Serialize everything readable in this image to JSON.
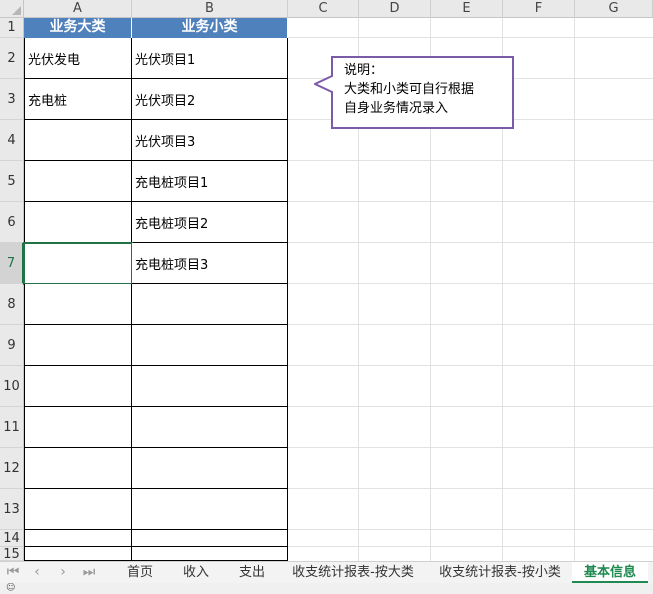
{
  "columns": [
    "A",
    "B",
    "C",
    "D",
    "E",
    "F",
    "G"
  ],
  "rows": [
    "1",
    "2",
    "3",
    "4",
    "5",
    "6",
    "7",
    "8",
    "9",
    "10",
    "11",
    "12",
    "13",
    "14",
    "15"
  ],
  "active_row": "7",
  "table": {
    "header": {
      "col_a": "业务大类",
      "col_b": "业务小类"
    },
    "col_a_values": [
      "光伏发电",
      "充电桩",
      "",
      "",
      "",
      "",
      "",
      "",
      "",
      "",
      "",
      "",
      "",
      ""
    ],
    "col_b_values": [
      "光伏项目1",
      "光伏项目2",
      "光伏项目3",
      "充电桩项目1",
      "充电桩项目2",
      "充电桩项目3",
      "",
      "",
      "",
      "",
      "",
      "",
      "",
      ""
    ]
  },
  "callout": {
    "text": "说明：\n大类和小类可自行根据\n自身业务情况录入"
  },
  "sheet_tabs": {
    "nav": [
      "|<",
      "<",
      ">",
      ">|"
    ],
    "tabs": [
      "首页",
      "收入",
      "支出",
      "收支统计报表-按大类",
      "收支统计报表-按小类",
      "基本信息"
    ],
    "active_tab": "基本信息"
  },
  "colors": {
    "header_fill": "#4f81bd",
    "header_text": "#ffffff",
    "active_green": "#1e8a50",
    "callout_border": "#7a5ba8"
  }
}
